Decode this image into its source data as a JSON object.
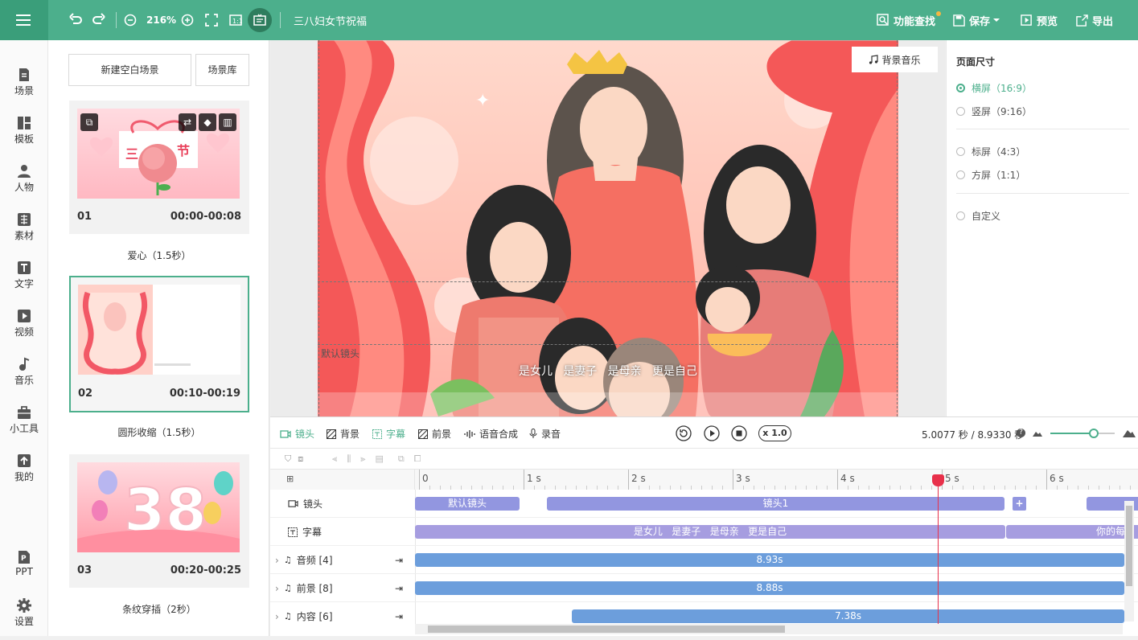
{
  "toolbar": {
    "zoom": "216%",
    "project_title": "三八妇女节祝福",
    "find_label": "功能查找",
    "save_label": "保存",
    "preview_label": "预览",
    "export_label": "导出"
  },
  "nav": [
    {
      "label": "场景",
      "icon": "scene-icon"
    },
    {
      "label": "模板",
      "icon": "template-icon"
    },
    {
      "label": "人物",
      "icon": "person-icon"
    },
    {
      "label": "素材",
      "icon": "material-icon"
    },
    {
      "label": "文字",
      "icon": "text-icon"
    },
    {
      "label": "视频",
      "icon": "video-icon"
    },
    {
      "label": "音乐",
      "icon": "music-icon"
    },
    {
      "label": "小工具",
      "icon": "tools-icon"
    },
    {
      "label": "我的",
      "icon": "upload-icon"
    },
    {
      "label": "PPT",
      "icon": "ppt-icon"
    },
    {
      "label": "设置",
      "icon": "gear-icon"
    }
  ],
  "scenes": {
    "new_blank": "新建空白场景",
    "library": "场景库",
    "items": [
      {
        "num": "01",
        "time": "00:00-00:08",
        "label": "爱心（1.5秒）",
        "thumb_title": "三八节"
      },
      {
        "num": "02",
        "time": "00:10-00:19",
        "label": "圆形收缩（1.5秒）"
      },
      {
        "num": "03",
        "time": "00:20-00:25",
        "label": "条纹穿插（2秒）",
        "thumb_title": "38"
      }
    ]
  },
  "stage": {
    "bgm_label": "背景音乐",
    "camera_label": "默认镜头",
    "subtitle": "是女儿   是妻子   是母亲   更是自己"
  },
  "page_size": {
    "title": "页面尺寸",
    "options": [
      {
        "label": "横屏（16:9）",
        "selected": true
      },
      {
        "label": "竖屏（9:16）",
        "selected": false
      },
      {
        "label": "标屏（4:3）",
        "selected": false
      },
      {
        "label": "方屏（1:1）",
        "selected": false
      },
      {
        "label": "自定义",
        "selected": false
      }
    ]
  },
  "timeline": {
    "tabs": [
      "镜头",
      "背景",
      "字幕",
      "前景",
      "语音合成",
      "录音"
    ],
    "speed": "x 1.0",
    "time": "5.0077 秒 / 8.9330 秒",
    "ruler": [
      "0",
      "1 s",
      "2 s",
      "3 s",
      "4 s",
      "5 s",
      "6 s"
    ],
    "rows": [
      {
        "label": "镜头"
      },
      {
        "label": "字幕"
      },
      {
        "label": "音频 [4]"
      },
      {
        "label": "前景 [8]"
      },
      {
        "label": "内容 [6]"
      }
    ],
    "camera_bars": [
      "默认镜头",
      "镜头1"
    ],
    "subtitle_bars": [
      "是女儿   是妻子   是母亲   更是自己",
      "你的每"
    ],
    "audio_bar": "8.93s",
    "foreground_bar": "8.88s",
    "content_bar": "7.38s",
    "playhead_seconds": 5.0077,
    "total_seconds": 8.933
  },
  "colors": {
    "accent": "#4caf8c",
    "camera_bar": "#9296e0",
    "subtitle_bar": "#a69de0",
    "track_bar": "#6c9edc",
    "playhead": "#e8304a"
  }
}
